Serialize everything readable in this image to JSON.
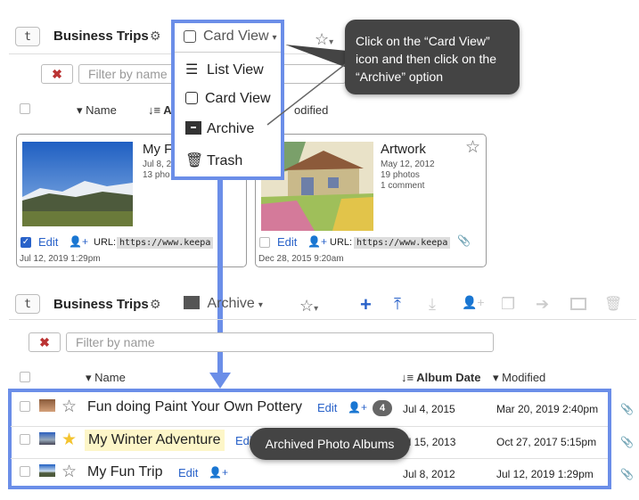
{
  "top": {
    "tag_label": "t",
    "title": "Business Trips",
    "view_label": "Card View",
    "star": "☆",
    "col_name": "Name",
    "col_album_date_partial": "A",
    "col_modified_partial": "odified"
  },
  "dropdown": {
    "items": [
      {
        "label": "List View",
        "icon": "list-icon"
      },
      {
        "label": "Card View",
        "icon": "card-icon"
      },
      {
        "label": "Archive",
        "icon": "archive-icon"
      },
      {
        "label": "Trash",
        "icon": "trash-icon"
      }
    ]
  },
  "callout_top": "Click on the “Card View” icon and then click on the “Archive” option",
  "cards": [
    {
      "title": "My F",
      "date": "Jul 8, 2",
      "photos": "13 pho",
      "comments": "",
      "edit": "Edit",
      "url_label": "URL:",
      "url_value": "https://www.keepa",
      "footer_date": "Jul 12, 2019 1:29pm",
      "checked": true
    },
    {
      "title": "Artwork",
      "date": "May 12, 2012",
      "photos": "19 photos",
      "comments": "1 comment",
      "edit": "Edit",
      "url_label": "URL:",
      "url_value": "https://www.keepa",
      "footer_date": "Dec 28, 2015 9:20am",
      "checked": false
    }
  ],
  "bottom": {
    "tag_label": "t",
    "title": "Business Trips",
    "view_label": "Archive",
    "filter_placeholder": "Filter by name",
    "col_name": "Name",
    "col_album_date": "Album Date",
    "col_modified": "Modified"
  },
  "filter_top_placeholder": "Filter by name",
  "rows": [
    {
      "name": "Fun doing Paint Your Own Pottery",
      "edit": "Edit",
      "badge": "4",
      "album_date": "Jul 4, 2015",
      "modified": "Mar 20, 2019 2:40pm",
      "starred": false,
      "highlight": false
    },
    {
      "name": "My Winter Adventure",
      "edit": "Edi",
      "badge": "",
      "album_date": "ul 15, 2013",
      "modified": "Oct 27, 2017 5:15pm",
      "starred": true,
      "highlight": true
    },
    {
      "name": "My Fun Trip",
      "edit": "Edit",
      "badge": "",
      "album_date": "Jul 8, 2012",
      "modified": "Jul 12, 2019 1:29pm",
      "starred": false,
      "highlight": false
    }
  ],
  "callout_bottom": "Archived Photo Albums",
  "colors": {
    "accent_blue": "#2962c9",
    "highlight_border": "#6b8ee8",
    "callout_bg": "#444444",
    "star_gold": "#f4c430"
  }
}
